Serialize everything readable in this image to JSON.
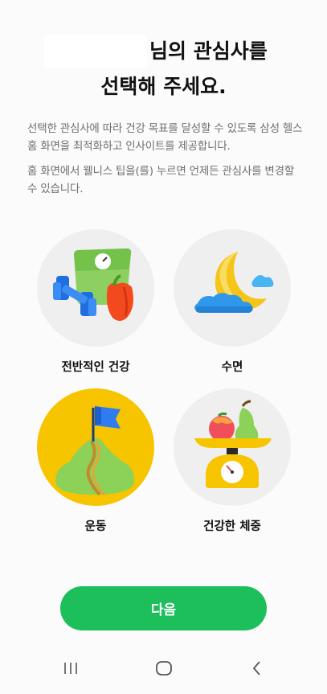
{
  "header": {
    "title_line1": "님의 관심사를",
    "title_line2": "선택해 주세요."
  },
  "description": {
    "para1": "선택한 관심사에 따라 건강 목표를 달성할 수 있도록 삼성 헬스 홈 화면을 최적화하고 인사이트를 제공합니다.",
    "para2": "홈 화면에서 웰니스 팁을(를) 누르면 언제든 관심사를 변경할 수 있습니다."
  },
  "interests": [
    {
      "label": "전반적인 건강",
      "icon": "general-health-icon",
      "selected": false
    },
    {
      "label": "수면",
      "icon": "sleep-moon-icon",
      "selected": false
    },
    {
      "label": "운동",
      "icon": "exercise-flag-icon",
      "selected": true
    },
    {
      "label": "건강한 체중",
      "icon": "weight-scale-icon",
      "selected": false
    }
  ],
  "next_button": {
    "label": "다음"
  },
  "colors": {
    "accent_green": "#1cbf5a",
    "selected_yellow": "#f7c400",
    "circle_gray": "#efefef"
  },
  "navbar": {
    "recents_icon": "recents-icon",
    "home_icon": "home-icon",
    "back_icon": "back-icon"
  }
}
